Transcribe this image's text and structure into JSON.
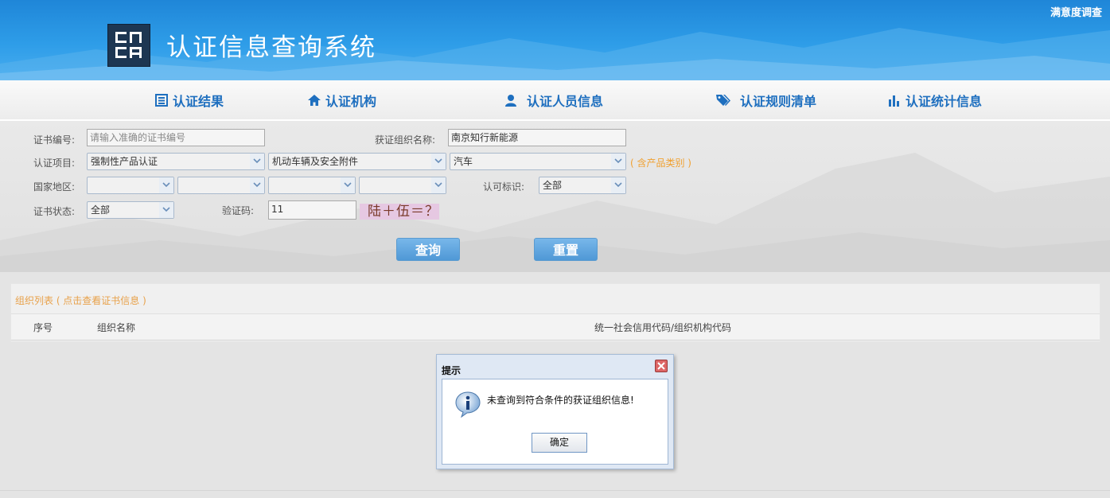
{
  "header": {
    "title": "认证信息查询系统",
    "survey_link": "满意度调查",
    "logo_text": "CNCA"
  },
  "nav": {
    "items": [
      {
        "label": "认证结果",
        "icon": "list-icon"
      },
      {
        "label": "认证机构",
        "icon": "home-icon"
      },
      {
        "label": "认证人员信息",
        "icon": "user-icon"
      },
      {
        "label": "认证规则清单",
        "icon": "tags-icon"
      },
      {
        "label": "认证统计信息",
        "icon": "bar-chart-icon"
      }
    ]
  },
  "search": {
    "cert_no_label": "证书编号:",
    "cert_no_placeholder": "请输入准确的证书编号",
    "org_name_label": "获证组织名称:",
    "org_name_value": "南京知行新能源",
    "project_label": "认证项目:",
    "project_values": [
      "强制性产品认证",
      "机动车辆及安全附件",
      "汽车"
    ],
    "product_hint": "( 含产品类别 )",
    "country_label": "国家地区:",
    "license_label": "认可标识:",
    "license_value": "全部",
    "status_label": "证书状态:",
    "status_value": "全部",
    "captcha_label": "验证码:",
    "captcha_value": "11",
    "captcha_text": "陆＋伍＝？",
    "query_button": "查询",
    "reset_button": "重置"
  },
  "list": {
    "title": "组织列表 ( 点击查看证书信息 )",
    "columns": [
      "序号",
      "组织名称",
      "统一社会信用代码/组织机构代码"
    ]
  },
  "dialog": {
    "title": "提示",
    "message": "未查询到符合条件的获证组织信息!",
    "ok_button": "确定"
  },
  "colors": {
    "header_blue": "#2e9de8",
    "nav_text": "#1e6fbf",
    "button_blue": "#5da6e0",
    "hint_orange": "#f0a030"
  }
}
